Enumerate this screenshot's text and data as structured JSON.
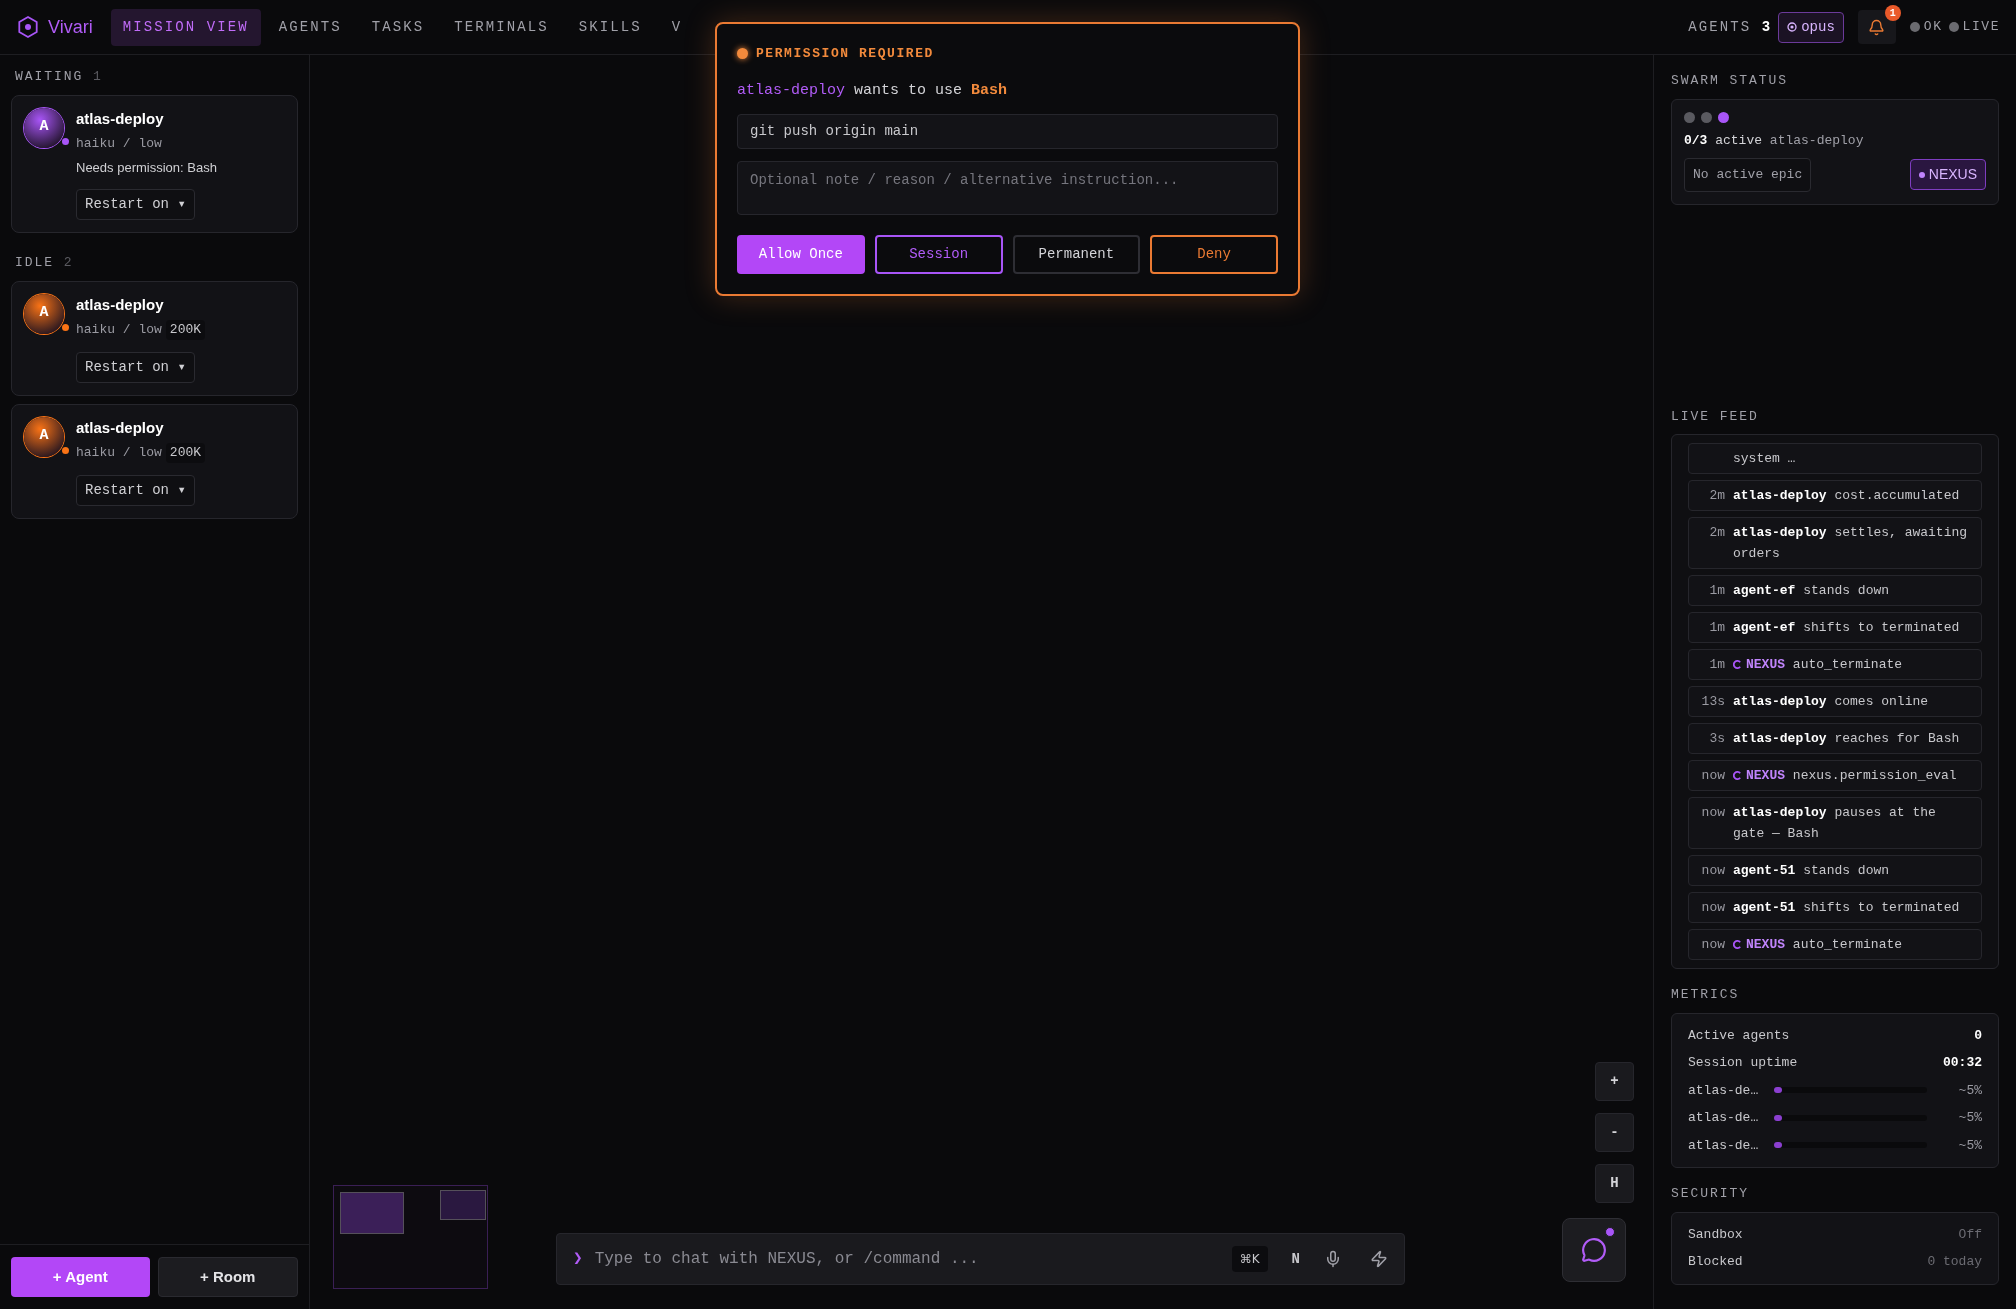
{
  "brand": {
    "name": "Vivari"
  },
  "nav": [
    {
      "label": "MISSION VIEW",
      "selected": true
    },
    {
      "label": "AGENTS",
      "selected": false
    },
    {
      "label": "TASKS",
      "selected": false
    },
    {
      "label": "TERMINALS",
      "selected": false
    },
    {
      "label": "SKILLS",
      "selected": false
    },
    {
      "label": "V",
      "selected": false
    }
  ],
  "header": {
    "agents_label": "AGENTS",
    "agents_count": "3",
    "model": "opus",
    "notifications": "1",
    "statuses": [
      {
        "label": "OK",
        "color": "#6b6b70"
      },
      {
        "label": "LIVE",
        "color": "#6b6b70"
      }
    ]
  },
  "sidebar": {
    "groups": [
      {
        "title": "WAITING",
        "count": "1",
        "agents": [
          {
            "initial": "A",
            "name": "atlas-deploy",
            "model": "haiku / low",
            "color": "#a855f7",
            "note": "Needs permission: Bash",
            "restart": "Restart on ▾"
          }
        ]
      },
      {
        "title": "IDLE",
        "count": "2",
        "agents": [
          {
            "initial": "A",
            "name": "atlas-deploy",
            "model": "haiku / low",
            "color": "#f97316",
            "tokens": "200K",
            "restart": "Restart on ▾"
          },
          {
            "initial": "A",
            "name": "atlas-deploy",
            "model": "haiku / low",
            "color": "#f97316",
            "tokens": "200K",
            "restart": "Restart on ▾"
          }
        ]
      }
    ],
    "buttons": [
      "+ Agent",
      "+ Room"
    ]
  },
  "permission": {
    "title": "PERMISSION REQUIRED",
    "agent": "atlas-deploy",
    "verb": "wants to use",
    "tool": "Bash",
    "command": "git push origin main",
    "note_placeholder": "Optional note / reason / alternative instruction...",
    "actions": [
      {
        "label": "Allow Once",
        "kind": "primary"
      },
      {
        "label": "Session",
        "kind": "outline"
      },
      {
        "label": "Permanent",
        "kind": "plain"
      },
      {
        "label": "Deny",
        "kind": "danger"
      }
    ]
  },
  "canvas": {
    "zoom_buttons": [
      "+",
      "-",
      "H"
    ]
  },
  "chat": {
    "prompt": "❯",
    "placeholder": "Type to chat with NEXUS, or /command ...",
    "shortcut": "⌘K",
    "mode": "N"
  },
  "swarm": {
    "title": "SWARM STATUS",
    "dots": [
      {
        "color": "#5a5a60"
      },
      {
        "color": "#5a5a60"
      },
      {
        "color": "#a855f7"
      }
    ],
    "ratio": "0/3",
    "active_label": "active",
    "agent": "atlas-deploy",
    "epic": "No active epic",
    "nexus": "NEXUS"
  },
  "feed": {
    "title": "LIVE FEED",
    "items": [
      {
        "kind": "agent",
        "text": "system …"
      },
      {
        "time": "2m",
        "actor": "atlas-deploy",
        "kind": "agent",
        "text": "cost.accumulated"
      },
      {
        "time": "2m",
        "actor": "atlas-deploy",
        "kind": "agent",
        "text": "settles, awaiting orders"
      },
      {
        "time": "1m",
        "actor": "agent-ef",
        "kind": "agent",
        "text": "stands down"
      },
      {
        "time": "1m",
        "actor": "agent-ef",
        "kind": "agent",
        "text": "shifts to terminated"
      },
      {
        "time": "1m",
        "actor": "NEXUS",
        "kind": "nexus",
        "text": "auto_terminate"
      },
      {
        "time": "13s",
        "actor": "atlas-deploy",
        "kind": "agent",
        "text": "comes online"
      },
      {
        "time": "3s",
        "actor": "atlas-deploy",
        "kind": "agent",
        "text": "reaches for Bash"
      },
      {
        "time": "now",
        "actor": "NEXUS",
        "kind": "nexus",
        "text": "nexus.permission_eval"
      },
      {
        "time": "now",
        "actor": "atlas-deploy",
        "kind": "agent",
        "text": "pauses at the gate — Bash"
      },
      {
        "time": "now",
        "actor": "agent-51",
        "kind": "agent",
        "text": "stands down"
      },
      {
        "time": "now",
        "actor": "agent-51",
        "kind": "agent",
        "text": "shifts to terminated"
      },
      {
        "time": "now",
        "actor": "NEXUS",
        "kind": "nexus",
        "text": "auto_terminate"
      }
    ]
  },
  "metrics": {
    "title": "METRICS",
    "stats": [
      {
        "label": "Active agents",
        "value": "0"
      },
      {
        "label": "Session uptime",
        "value": "00:32"
      }
    ],
    "usage": [
      {
        "name": "atlas-de…",
        "level": 0.05,
        "reading": "~5%"
      },
      {
        "name": "atlas-de…",
        "level": 0.05,
        "reading": "~5%"
      },
      {
        "name": "atlas-de…",
        "level": 0.05,
        "reading": "~5%"
      }
    ]
  },
  "security": {
    "title": "SECURITY",
    "rows": [
      {
        "label": "Sandbox",
        "value": "Off"
      },
      {
        "label": "Blocked",
        "value": "0 today"
      }
    ]
  }
}
